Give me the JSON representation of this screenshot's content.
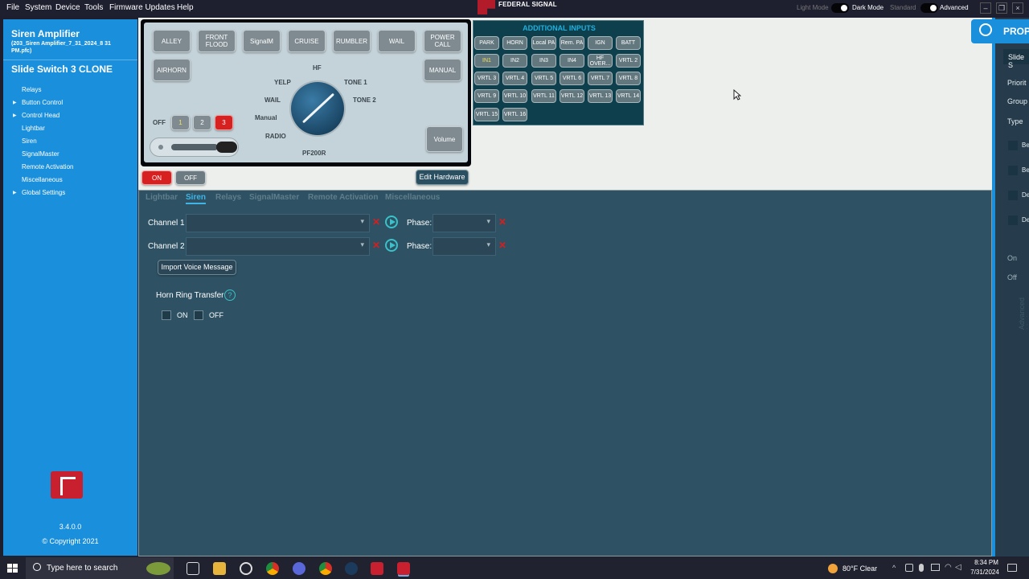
{
  "menubar": {
    "items": [
      "File",
      "System",
      "Device",
      "Tools",
      "Firmware Updates",
      "Help"
    ],
    "brand": "FEDERAL SIGNAL",
    "light_mode": "Light Mode",
    "dark_mode": "Dark Mode",
    "standard": "Standard",
    "advanced": "Advanced",
    "window_buttons": [
      "–",
      "❐",
      "×"
    ]
  },
  "sidebar": {
    "title": "Siren Amplifier",
    "file": "(203_Siren Amplifier_7_31_2024_8 31 PM.pfc)",
    "subtitle": "Slide Switch 3 CLONE",
    "items": [
      "Relays",
      "Button Control",
      "Control Head",
      "Lightbar",
      "Siren",
      "SignalMaster",
      "Remote Activation",
      "Miscellaneous",
      "Global Settings"
    ],
    "version": "3.4.0.0",
    "copyright": "© Copyright 2021"
  },
  "hardware": {
    "top_buttons": [
      "ALLEY",
      "FRONT FLOOD",
      "SignalM",
      "CRUISE",
      "RUMBLER",
      "WAIL",
      "POWER CALL"
    ],
    "airhorn": "AIRHORN",
    "manual": "MANUAL",
    "volume": "Volume",
    "off_label": "OFF",
    "num_buttons": [
      "1",
      "2",
      "3"
    ],
    "knob_labels": {
      "hf": "HF",
      "yelp": "YELP",
      "tone1": "TONE 1",
      "wail": "WAIL",
      "tone2": "TONE 2",
      "manual": "Manual",
      "radio": "RADIO",
      "model": "PF200R"
    },
    "on_btn": "ON",
    "off_btn": "OFF",
    "edit_hardware": "Edit Hardware"
  },
  "additional_inputs": {
    "header": "ADDITIONAL INPUTS",
    "rows": [
      [
        "PARK",
        "HORN",
        "Local PA",
        "Rem. PA",
        "IGN",
        "BATT"
      ],
      [
        "IN1",
        "IN2",
        "IN3",
        "IN4",
        "HF OVER...",
        "VRTL 2"
      ],
      [
        "VRTL 3",
        "VRTL 4",
        "VRTL 5",
        "VRTL 6",
        "VRTL 7",
        "VRTL 8"
      ],
      [
        "VRTL 9",
        "VRTL 10",
        "VRTL 11",
        "VRTL 12",
        "VRTL 13",
        "VRTL 14"
      ],
      [
        "VRTL 15",
        "VRTL 16"
      ]
    ]
  },
  "tabs": [
    "Lightbar",
    "Siren",
    "Relays",
    "SignalMaster",
    "Remote Activation",
    "Miscellaneous"
  ],
  "siren": {
    "channel1": "Channel 1",
    "channel2": "Channel 2",
    "phase": "Phase:",
    "import_voice": "Import Voice Message",
    "horn_ring": "Horn Ring Transfer",
    "help": "?",
    "on": "ON",
    "off": "OFF"
  },
  "properties": {
    "badge": "PROP",
    "slide": "Slide S",
    "labels": [
      "Priorit",
      "Group",
      "Type"
    ],
    "checks": [
      "Be",
      "Be",
      "De",
      "De"
    ],
    "on": "On",
    "off": "Off",
    "vertical": "Advanced Mode"
  },
  "taskbar": {
    "search": "Type here to search",
    "weather": "80°F  Clear",
    "time": "8:34 PM",
    "date": "7/31/2024"
  }
}
